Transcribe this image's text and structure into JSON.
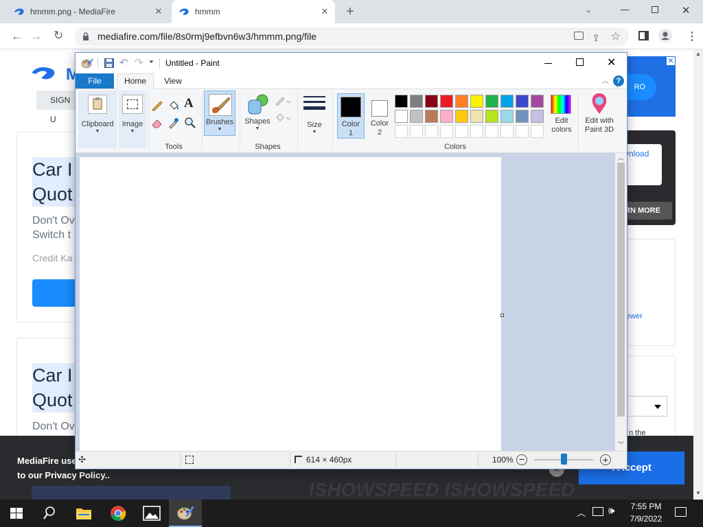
{
  "browser": {
    "tabs": [
      {
        "title": "hmmm.png - MediaFire"
      },
      {
        "title": "hmmm"
      }
    ],
    "url": "mediafire.com/file/8s0rmj9efbvn6w3/hmmm.png/file"
  },
  "mediafire": {
    "signup": "SIGN U",
    "cards": [
      {
        "title_line1": "Car I",
        "title_line2": "Quot",
        "sub_line1": "Don't Ov",
        "sub_line2": "Switch t",
        "source": "Credit Ka"
      },
      {
        "title_line1": "Car I",
        "title_line2": "Quot",
        "sub_line1": "Don't Ov"
      }
    ],
    "right": {
      "pro_label": "RO",
      "download_label": "vnload",
      "learn_more": "RN MORE",
      "viewer_link": "ewer",
      "the_text": "n the"
    },
    "cookie": {
      "text_line1": "MediaFire use",
      "text_line2": "to our Privacy Policy..",
      "accept": "I Accept"
    },
    "watermark": "ISHOWSPEED   ISHOWSPEED"
  },
  "paint": {
    "title": "Untitled - Paint",
    "tabs": {
      "file": "File",
      "home": "Home",
      "view": "View"
    },
    "groups": {
      "clipboard": "Clipboard",
      "image": "Image",
      "tools": "Tools",
      "brushes": "Brushes",
      "shapes_btn": "Shapes",
      "shapes_group": "Shapes",
      "size": "Size",
      "color1": "Color",
      "color1_num": "1",
      "color2": "Color",
      "color2_num": "2",
      "colors_group": "Colors",
      "edit_colors_1": "Edit",
      "edit_colors_2": "colors",
      "paint3d_1": "Edit with",
      "paint3d_2": "Paint 3D"
    },
    "palette_row1": [
      "#000000",
      "#7f7f7f",
      "#880015",
      "#ed1c24",
      "#ff7f27",
      "#fff200",
      "#22b14c",
      "#00a2e8",
      "#3f48cc",
      "#a349a4"
    ],
    "palette_row2": [
      "#ffffff",
      "#c3c3c3",
      "#b97a57",
      "#ffaec9",
      "#ffc90e",
      "#efe4b0",
      "#b5e61d",
      "#99d9ea",
      "#7092be",
      "#c8bfe7"
    ],
    "color1": "#000000",
    "color2": "#ffffff",
    "status": {
      "size": "614 × 460px",
      "zoom": "100%"
    },
    "zoom_level": 0.5
  },
  "taskbar": {
    "time": "7:55 PM",
    "date": "7/9/2022"
  }
}
